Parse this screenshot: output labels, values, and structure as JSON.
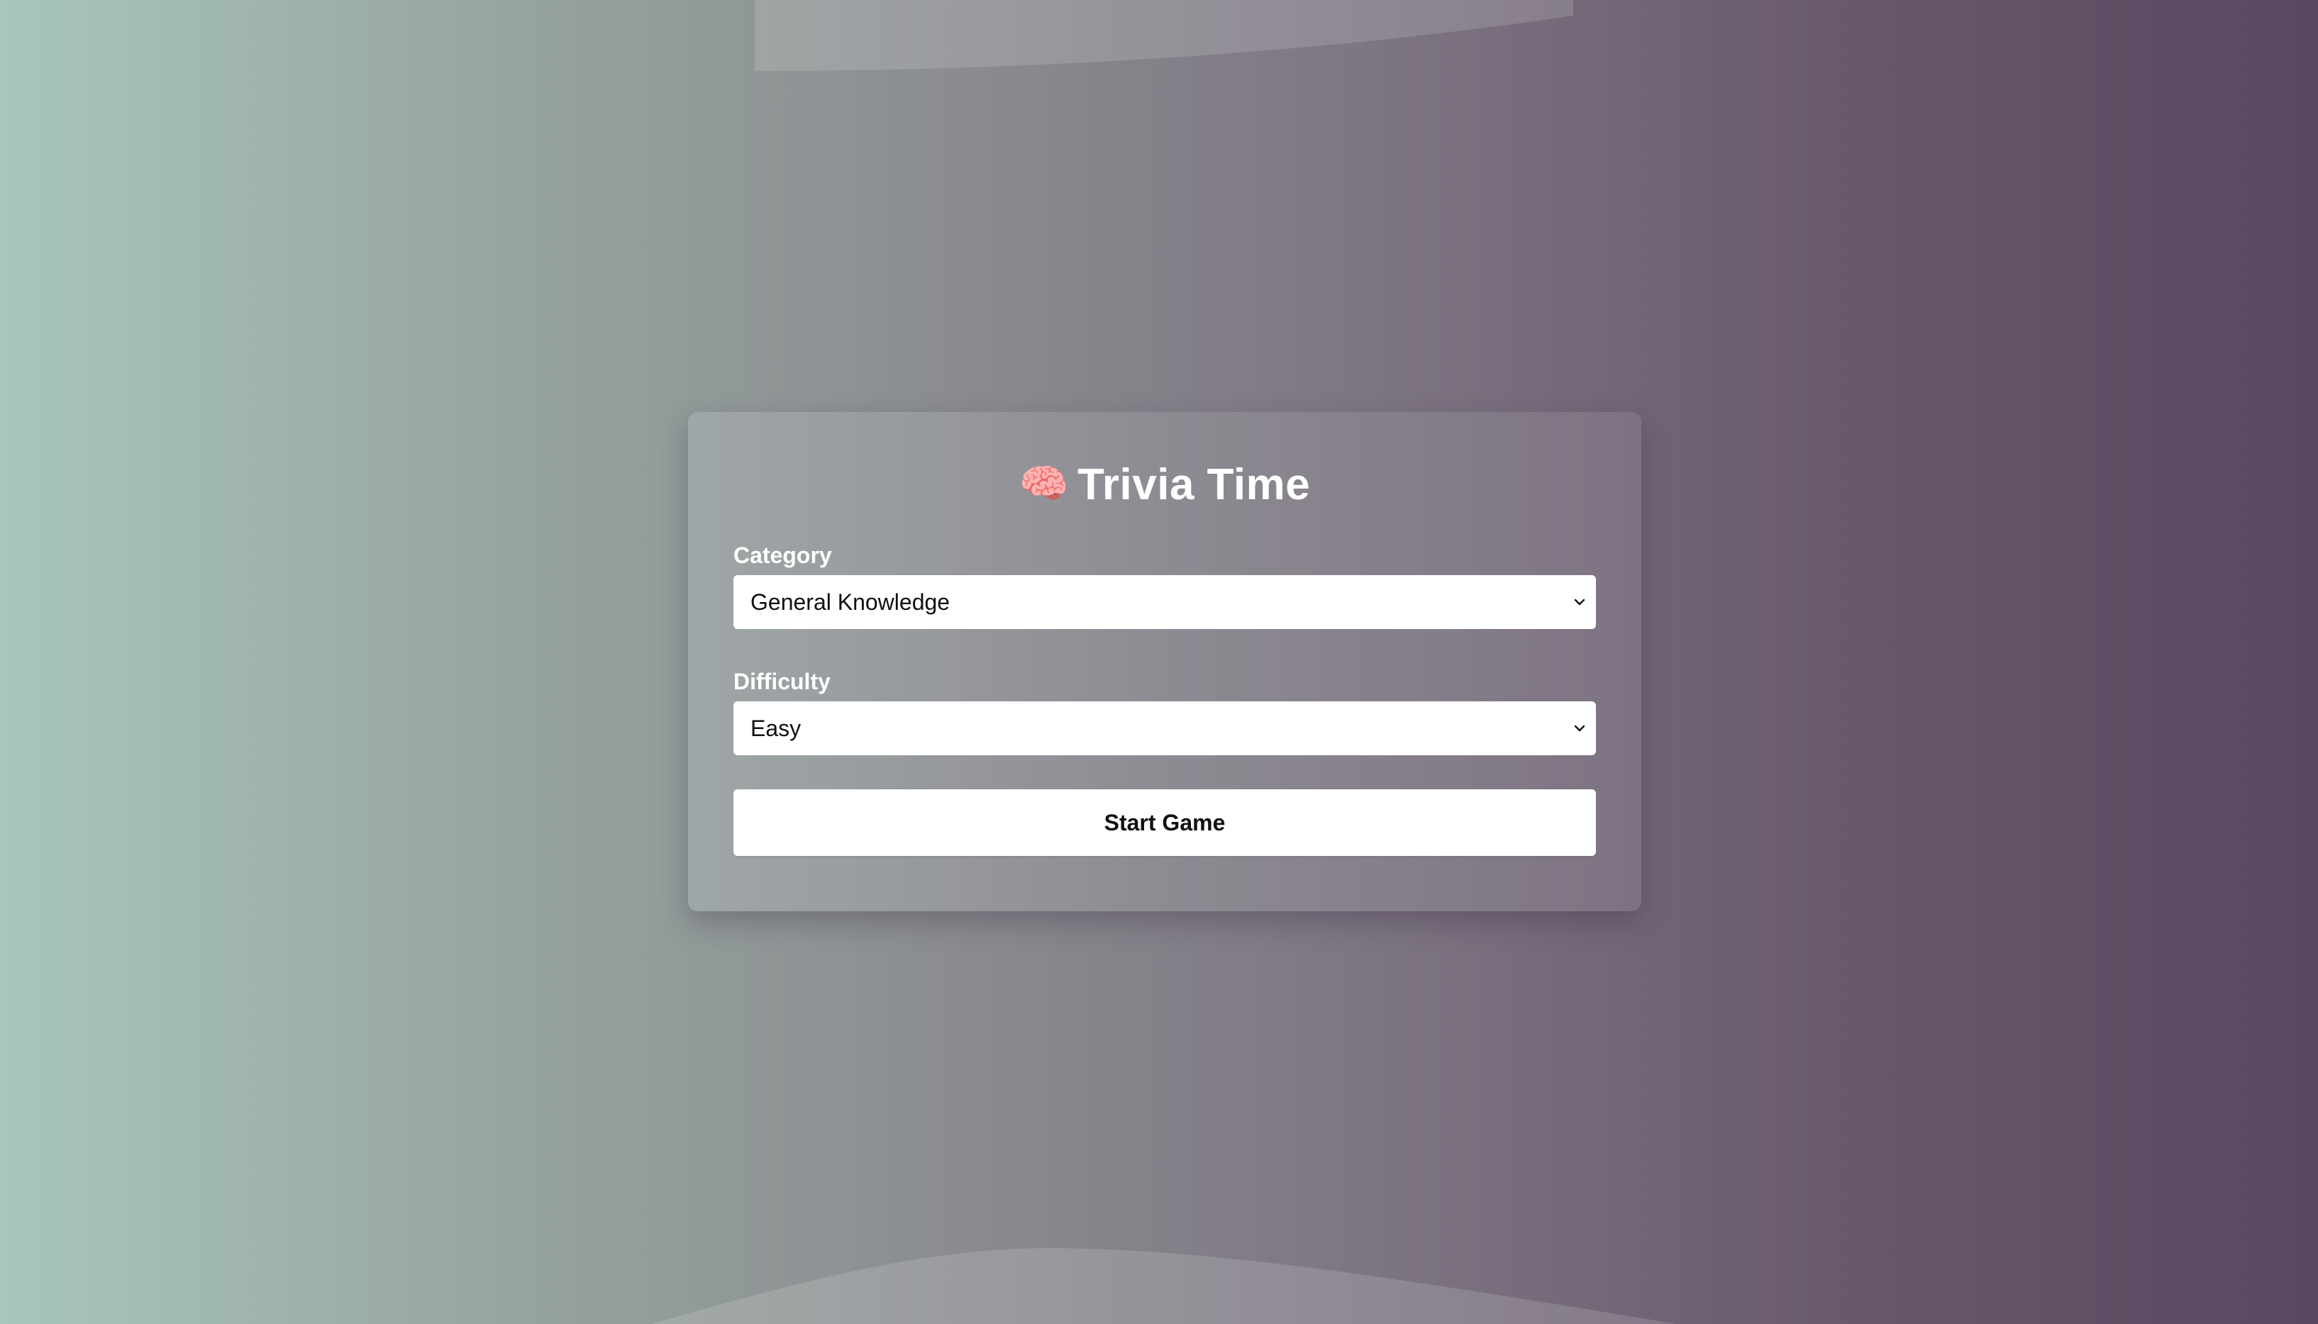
{
  "app": {
    "title": "Trivia Time",
    "title_icon": "brain-icon",
    "brain_glyph": "🧠"
  },
  "form": {
    "category": {
      "label": "Category",
      "selected": "General Knowledge"
    },
    "difficulty": {
      "label": "Difficulty",
      "selected": "Easy"
    },
    "start_button": "Start Game"
  },
  "colors": {
    "background_left": "#a8c6ba",
    "background_right": "#5a4660",
    "text_on_card": "#ffffff",
    "input_background": "#ffffff",
    "input_text": "#111111"
  }
}
